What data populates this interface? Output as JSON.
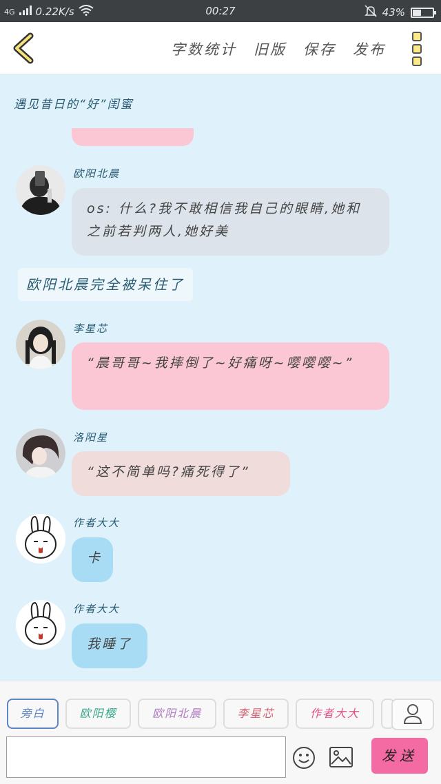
{
  "status_bar": {
    "network": "4G",
    "speed": "0.22K/s",
    "time": "00:27",
    "battery": "43%",
    "battery_level": 0.43
  },
  "topbar": {
    "links": [
      "字数统计",
      "旧版",
      "保存",
      "发布"
    ]
  },
  "chapter_title": "遇见昔日的“好”闺蜜",
  "messages": [
    {
      "name": "欧阳北晨",
      "text": "os: 什么?我不敢相信我自己的眼睛,她和之前若判两人,她好美",
      "color": "#dce3ea"
    },
    {
      "narration": "欧阳北晨完全被呆住了"
    },
    {
      "name": "李星芯",
      "text": "“晨哥哥~我摔倒了~好痛呀~嘤嘤嘤~”",
      "color": "#fcc7d4"
    },
    {
      "name": "洛阳星",
      "text": "“这不简单吗?痛死得了”",
      "color": "#f1dcdc"
    },
    {
      "name": "作者大大",
      "text": "卡",
      "color": "#a8dcf5"
    },
    {
      "name": "作者大大",
      "text": "我睡了",
      "color": "#a8dcf5"
    }
  ],
  "bottom": {
    "chips": [
      {
        "label": "旁白",
        "color": "#5d84c4"
      },
      {
        "label": "欧阳樱",
        "color": "#3aa88e"
      },
      {
        "label": "欧阳北晨",
        "color": "#b07cc2"
      },
      {
        "label": "李星芯",
        "color": "#d25a6b"
      },
      {
        "label": "作者大大",
        "color": "#e24f86"
      }
    ],
    "input_placeholder": "",
    "send_label": "发送"
  }
}
